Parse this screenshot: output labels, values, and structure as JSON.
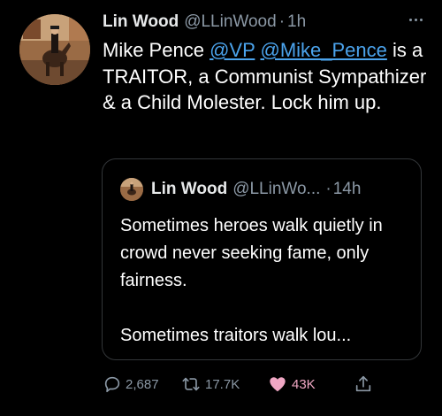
{
  "tweet": {
    "author_name": "Lin Wood",
    "author_handle": "@LLinWood",
    "separator": "·",
    "time": "1h",
    "text_parts": {
      "before": "Mike Pence ",
      "mention1": "@VP",
      "space": " ",
      "mention2": "@Mike_Pence",
      "after": " is a TRAITOR, a Communist Sympathizer & a Child Molester. Lock him up."
    }
  },
  "quoted": {
    "author_name": "Lin Wood",
    "author_handle": "@LLinWo...",
    "separator": "·",
    "time": "14h",
    "line1": "Sometimes heroes walk quietly in crowd never seeking fame, only fairness.",
    "line2": "Sometimes traitors walk lou..."
  },
  "actions": {
    "reply_count": "2,687",
    "retweet_count": "17.7K",
    "like_count": "43K"
  },
  "colors": {
    "background": "#000000",
    "text": "#ffffff",
    "muted": "#8b98a5",
    "link": "#4ba3ec",
    "like": "#f0a7c4",
    "border": "#333639"
  },
  "icons": {
    "more": "more-dots-icon",
    "reply": "reply-icon",
    "retweet": "retweet-icon",
    "like": "heart-icon",
    "share": "share-icon"
  }
}
